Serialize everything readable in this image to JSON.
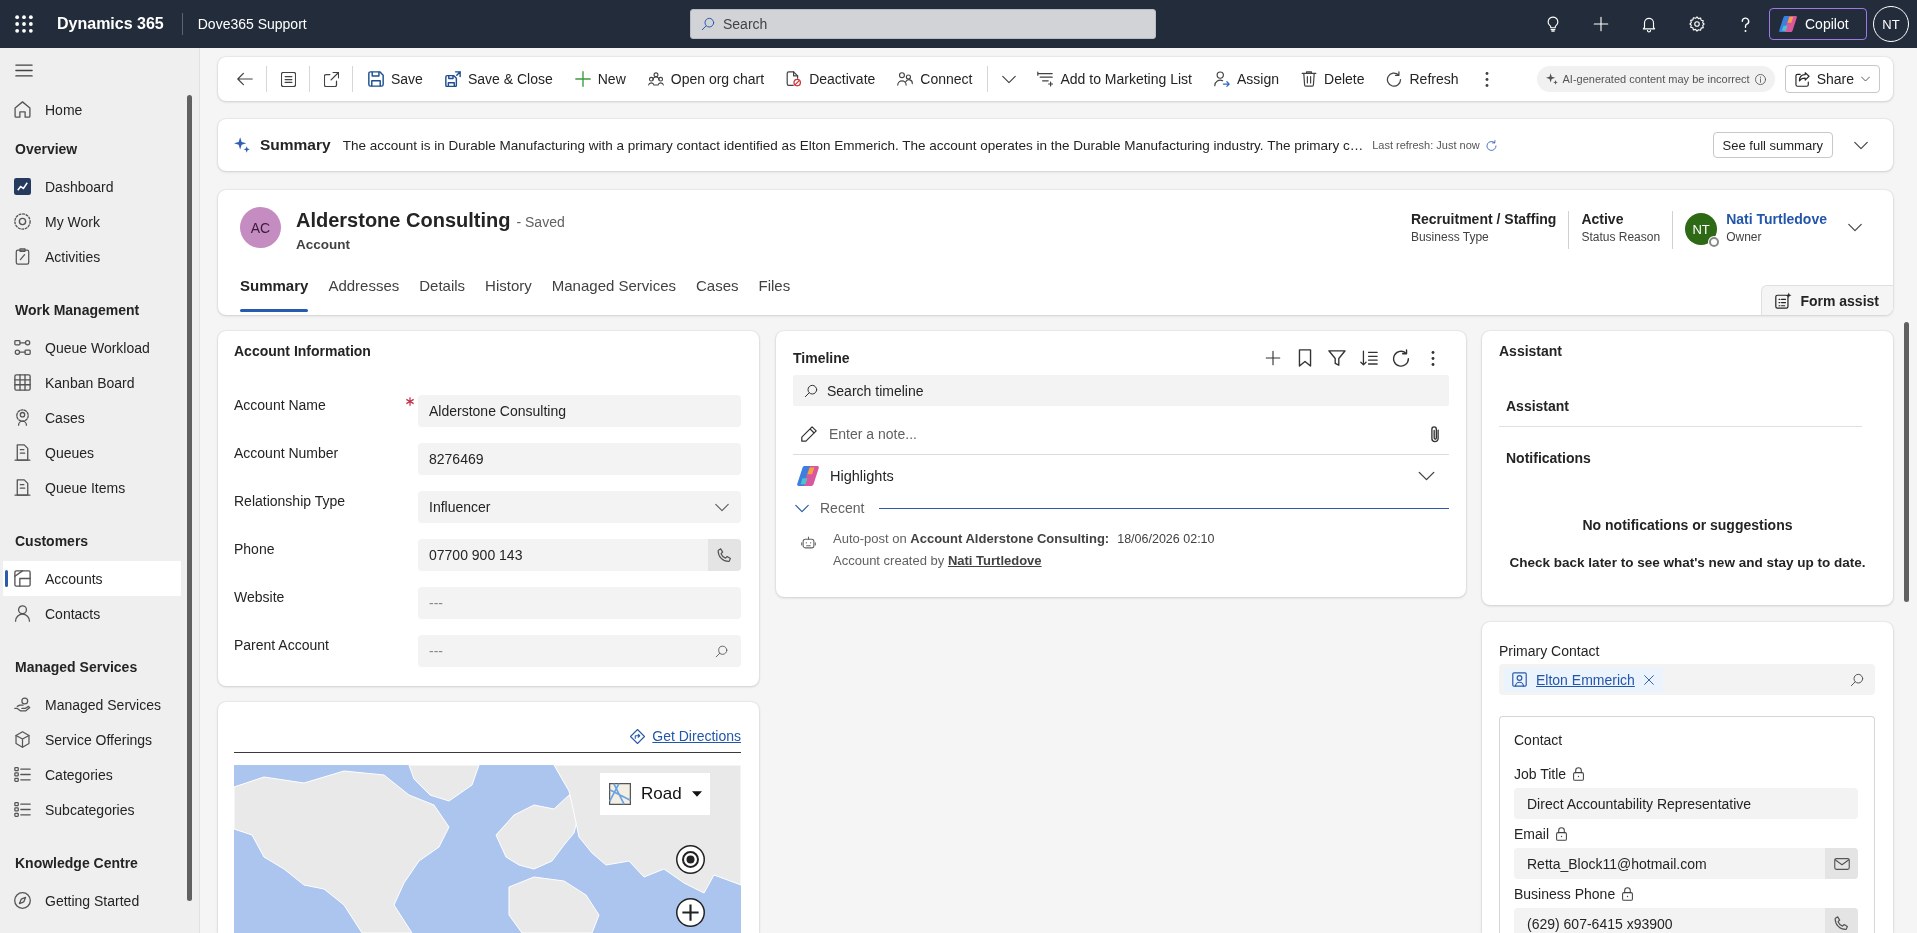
{
  "top_bar": {
    "app_name": "Dynamics 365",
    "app_context": "Dove365 Support",
    "search": {
      "placeholder": "Search"
    },
    "copilot": "Copilot",
    "user_initials": "NT"
  },
  "sidebar": {
    "home": {
      "label": "Home",
      "selected": false
    },
    "groups": [
      {
        "heading": "Overview",
        "items": [
          {
            "label": "Dashboard",
            "selected": false
          },
          {
            "label": "My Work",
            "selected": false
          },
          {
            "label": "Activities",
            "selected": false
          }
        ]
      },
      {
        "heading": "Work Management",
        "items": [
          {
            "label": "Queue Workload",
            "selected": false
          },
          {
            "label": "Kanban Board",
            "selected": false
          },
          {
            "label": "Cases",
            "selected": false
          },
          {
            "label": "Queues",
            "selected": false
          },
          {
            "label": "Queue Items",
            "selected": false
          }
        ]
      },
      {
        "heading": "Customers",
        "items": [
          {
            "label": "Accounts",
            "selected": true
          },
          {
            "label": "Contacts",
            "selected": false
          }
        ]
      },
      {
        "heading": "Managed Services",
        "items": [
          {
            "label": "Managed Services",
            "selected": false
          },
          {
            "label": "Service Offerings",
            "selected": false
          },
          {
            "label": "Categories",
            "selected": false
          },
          {
            "label": "Subcategories",
            "selected": false
          }
        ]
      },
      {
        "heading": "Knowledge Centre",
        "items": [
          {
            "label": "Getting Started",
            "selected": false
          }
        ]
      }
    ]
  },
  "command_bar": {
    "commands": [
      {
        "label": "Save",
        "kind": "button"
      },
      {
        "label": "Save & Close",
        "kind": "button"
      },
      {
        "label": "New",
        "kind": "button"
      },
      {
        "label": "Open org chart",
        "kind": "button"
      },
      {
        "label": "Deactivate",
        "kind": "button"
      },
      {
        "label": "Connect",
        "kind": "split"
      },
      {
        "label": "Add to Marketing List",
        "kind": "button"
      },
      {
        "label": "Assign",
        "kind": "button"
      },
      {
        "label": "Delete",
        "kind": "button"
      },
      {
        "label": "Refresh",
        "kind": "button"
      }
    ],
    "ai_notice": "AI-generated content may be incorrect",
    "share": "Share"
  },
  "summary": {
    "title": "Summary",
    "text": "The account is in Durable Manufacturing with a primary contact identified as Elton Emmerich. The account operates in the Durable Manufacturing industry. The primary c…",
    "last_refresh": "Last refresh: Just now",
    "button": "See full summary"
  },
  "record_header": {
    "avatar": "AC",
    "name": "Alderstone Consulting",
    "save_status": "- Saved",
    "entity": "Account",
    "fields": [
      {
        "value": "Recruitment / Staffing",
        "label": "Business Type"
      },
      {
        "value": "Active",
        "label": "Status Reason"
      }
    ],
    "owner": {
      "avatar": "NT",
      "name": "Nati Turtledove",
      "label": "Owner"
    },
    "tabs": [
      {
        "label": "Summary",
        "selected": true
      },
      {
        "label": "Addresses",
        "selected": false
      },
      {
        "label": "Details",
        "selected": false
      },
      {
        "label": "History",
        "selected": false
      },
      {
        "label": "Managed Services",
        "selected": false
      },
      {
        "label": "Cases",
        "selected": false
      },
      {
        "label": "Files",
        "selected": false
      }
    ],
    "form_assist": "Form assist"
  },
  "account_information": {
    "title": "Account Information",
    "fields": [
      {
        "label": "Account Name",
        "value": "Alderstone Consulting",
        "required": true,
        "kind": "text"
      },
      {
        "label": "Account Number",
        "value": "8276469",
        "required": false,
        "kind": "text"
      },
      {
        "label": "Relationship Type",
        "value": "Influencer",
        "required": false,
        "kind": "select"
      },
      {
        "label": "Phone",
        "value": "07700 900 143",
        "required": false,
        "kind": "phone"
      },
      {
        "label": "Website",
        "placeholder": "---",
        "required": false,
        "kind": "text"
      },
      {
        "label": "Parent Account",
        "placeholder": "---",
        "required": false,
        "kind": "lookup"
      }
    ]
  },
  "map": {
    "directions": "Get Directions",
    "map_style": "Road"
  },
  "timeline": {
    "title": "Timeline",
    "search": {
      "placeholder": "Search timeline"
    },
    "note": {
      "placeholder": "Enter a note..."
    },
    "highlights": "Highlights",
    "recent": "Recent",
    "entries": [
      {
        "text": "Auto-post on **Account Alderstone Consulting:**",
        "time": "18/06/2026 02:10",
        "detail": "Account created by",
        "author": "Nati Turtledove"
      }
    ]
  },
  "assistant": {
    "title": "Assistant",
    "section": "Assistant",
    "notifications": "Notifications",
    "empty_title": "No notifications or suggestions",
    "empty_text": "Check back later to see what's new and stay up to date."
  },
  "primary_contact": {
    "label": "Primary Contact",
    "value": "Elton Emmerich",
    "contact": {
      "title": "Contact",
      "fields": [
        {
          "label": "Job Title",
          "value": "Direct Accountability Representative",
          "locked": true,
          "kind": "text"
        },
        {
          "label": "Email",
          "value": "Retta_Block11@hotmail.com",
          "locked": true,
          "kind": "email"
        },
        {
          "label": "Business Phone",
          "value": "(629) 607-6415 x93900",
          "locked": true,
          "kind": "phone"
        }
      ]
    }
  }
}
